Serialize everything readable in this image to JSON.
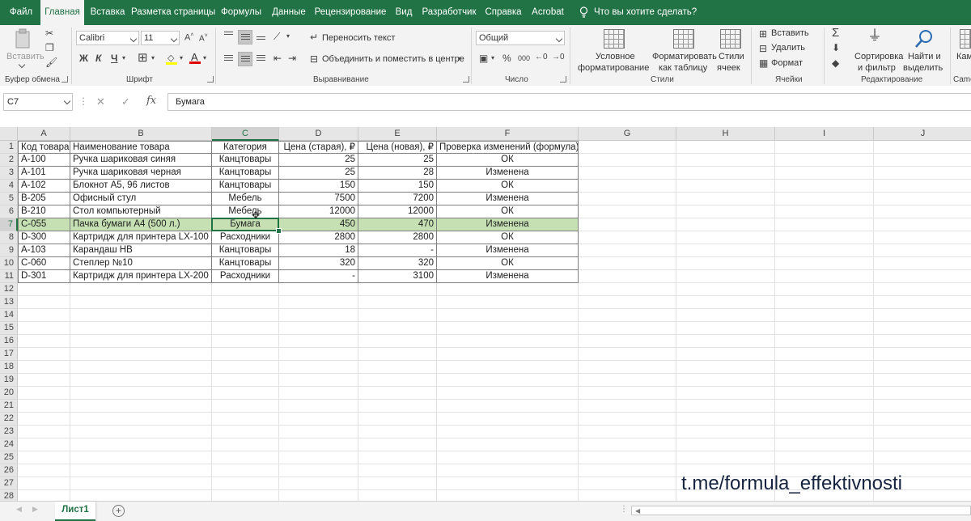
{
  "menu": {
    "tabs": [
      {
        "label": "Файл",
        "active": false
      },
      {
        "label": "Главная",
        "active": true
      },
      {
        "label": "Вставка",
        "active": false
      },
      {
        "label": "Разметка страницы",
        "active": false
      },
      {
        "label": "Формулы",
        "active": false
      },
      {
        "label": "Данные",
        "active": false
      },
      {
        "label": "Рецензирование",
        "active": false
      },
      {
        "label": "Вид",
        "active": false
      },
      {
        "label": "Разработчик",
        "active": false
      },
      {
        "label": "Справка",
        "active": false
      },
      {
        "label": "Acrobat",
        "active": false
      }
    ],
    "tell_me": "Что вы хотите сделать?"
  },
  "ribbon": {
    "clipboard": {
      "paste": "Вставить",
      "label": "Буфер обмена"
    },
    "font": {
      "name": "Calibri",
      "size": "11",
      "bold": "Ж",
      "italic": "К",
      "underline": "Ч",
      "color_letter": "A",
      "label": "Шрифт"
    },
    "alignment": {
      "wrap": "Переносить текст",
      "merge": "Объединить и поместить в центре",
      "label": "Выравнивание"
    },
    "number": {
      "format": "Общий",
      "percent": "%",
      "thousands": "000",
      "label": "Число"
    },
    "styles": {
      "conditional_1": "Условное",
      "conditional_2": "форматирование",
      "table_1": "Форматировать",
      "table_2": "как таблицу",
      "cell_1": "Стили",
      "cell_2": "ячеек",
      "label": "Стили"
    },
    "cells": {
      "insert": "Вставить",
      "delete": "Удалить",
      "format": "Формат",
      "label": "Ячейки"
    },
    "editing": {
      "sort_1": "Сортировка",
      "sort_2": "и фильтр",
      "find_1": "Найти и",
      "find_2": "выделить",
      "label": "Редактирование"
    },
    "cut_group": {
      "label_1": "Кам",
      "label_2": "Came"
    }
  },
  "formula_bar": {
    "name_box": "C7",
    "fx": "fx",
    "value": "Бумага"
  },
  "columns": [
    "A",
    "B",
    "C",
    "D",
    "E",
    "F",
    "G",
    "H",
    "I",
    "J"
  ],
  "rows": [
    "1",
    "2",
    "3",
    "4",
    "5",
    "6",
    "7",
    "8",
    "9",
    "10",
    "11",
    "12",
    "13",
    "14",
    "15",
    "16",
    "17",
    "18",
    "19",
    "20",
    "21",
    "22",
    "23",
    "24",
    "25",
    "26",
    "27",
    "28"
  ],
  "selected_cell": {
    "col": "C",
    "row": "7"
  },
  "table": {
    "headers": [
      "Код товара",
      "Наименование товара",
      "Категория",
      "Цена (старая), ₽",
      "Цена (новая), ₽",
      "Проверка изменений (формула)"
    ],
    "rows": [
      [
        "A-100",
        "Ручка шариковая синяя",
        "Канцтовары",
        "25",
        "25",
        "ОК"
      ],
      [
        "A-101",
        "Ручка шариковая черная",
        "Канцтовары",
        "25",
        "28",
        "Изменена"
      ],
      [
        "A-102",
        "Блокнот А5, 96 листов",
        "Канцтовары",
        "150",
        "150",
        "ОК"
      ],
      [
        "B-205",
        "Офисный стул",
        "Мебель",
        "7500",
        "7200",
        "Изменена"
      ],
      [
        "B-210",
        "Стол компьютерный",
        "Мебель",
        "12000",
        "12000",
        "ОК"
      ],
      [
        "C-055",
        "Пачка бумаги А4 (500 л.)",
        "Бумага",
        "450",
        "470",
        "Изменена"
      ],
      [
        "D-300",
        "Картридж для принтера LX-100",
        "Расходники",
        "2800",
        "2800",
        "ОК"
      ],
      [
        "A-103",
        "Карандаш HB",
        "Канцтовары",
        "18",
        "-",
        "Изменена"
      ],
      [
        "C-060",
        "Степлер №10",
        "Канцтовары",
        "320",
        "320",
        "ОК"
      ],
      [
        "D-301",
        "Картридж для принтера LX-200",
        "Расходники",
        "-",
        "3100",
        "Изменена"
      ]
    ],
    "highlight_color": "#c6e0b4"
  },
  "sheet_tabs": [
    {
      "label": "Лист1",
      "active": true
    }
  ],
  "watermark": "t.me/formula_effektivnosti",
  "colors": {
    "accent": "#217346",
    "highlight": "#c6e0b4"
  }
}
